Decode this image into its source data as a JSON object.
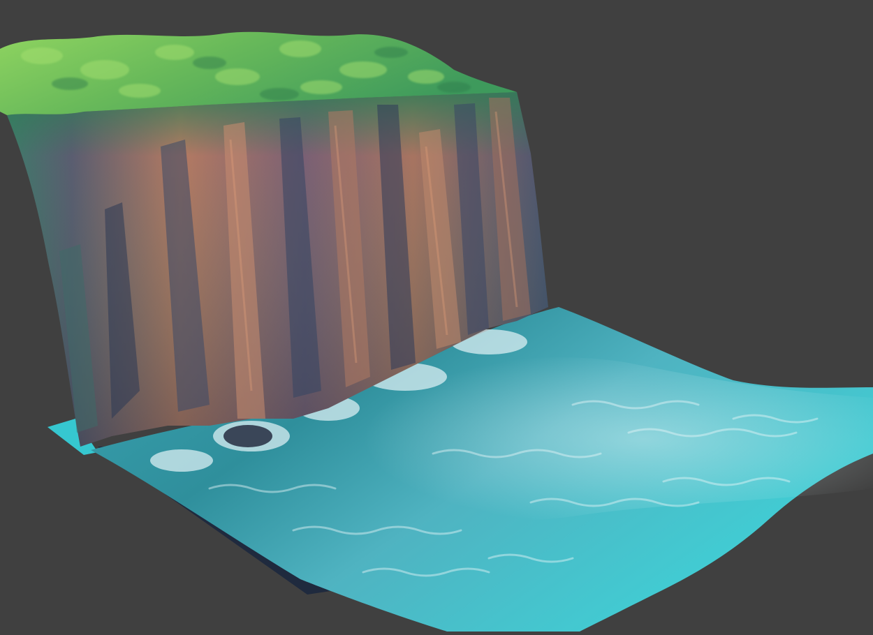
{
  "viewport": {
    "background": "#404040"
  },
  "scene": {
    "description_icon": "terrain-render",
    "colors": {
      "grass_light": "#7fd65a",
      "grass_dark": "#3f8a4e",
      "rock_warm": "#b8785c",
      "rock_cool": "#3c4c66",
      "water_deep": "#1e6f86",
      "water_shallow": "#38d2d4",
      "foam": "#d9eef2",
      "base_shadow": "#1f2a3e"
    }
  }
}
